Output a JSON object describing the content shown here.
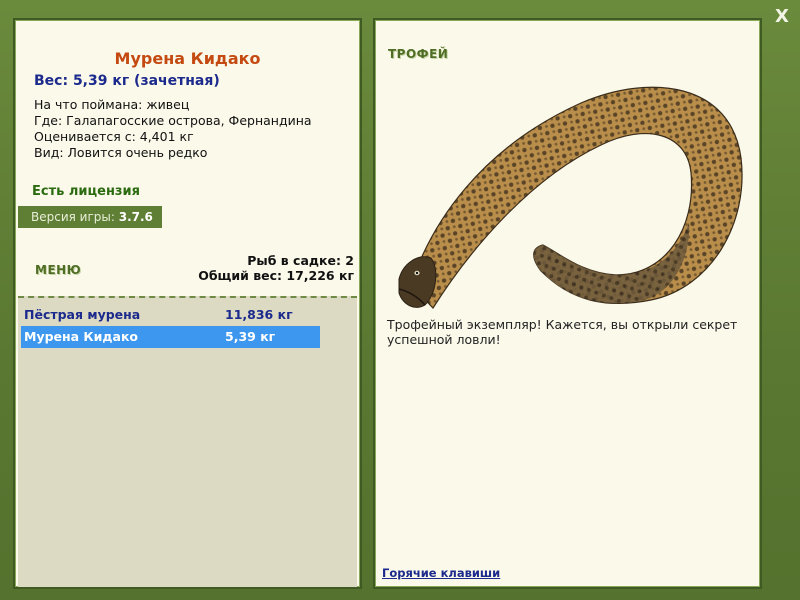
{
  "window": {
    "close_label": "X"
  },
  "fish": {
    "title": "Мурена Кидако",
    "weight_line": "Вес: 5,39 кг (зачетная)",
    "info": [
      "На что поймана: живец",
      "Где: Галапагосские острова, Фернандина",
      "Оценивается с: 4,401 кг",
      "Вид: Ловится очень редко"
    ],
    "license": "Есть лицензия",
    "version_prefix": "Версия игры: ",
    "version_value": "3.7.6"
  },
  "menu": {
    "label": "МЕНЮ",
    "fish_count": "Рыб в садке: 2",
    "total_weight": "Общий вес: 17,226 кг"
  },
  "list": [
    {
      "name": "Пёстрая мурена",
      "weight": "11,836 кг",
      "selected": false
    },
    {
      "name": "Мурена Кидако",
      "weight": "5,39 кг",
      "selected": true
    }
  ],
  "trophy": {
    "label": "ТРОФЕЙ",
    "description": "Трофейный экземпляр! Кажется, вы открыли секрет успешной ловли!",
    "hotkeys_link": "Горячие клавиши"
  },
  "colors": {
    "frame": "#5d7a34",
    "panel": "#fbf9ea",
    "title": "#c44a12",
    "weight": "#1b2a8c",
    "license": "#2b6b10",
    "selected_row": "#3d97ee"
  }
}
